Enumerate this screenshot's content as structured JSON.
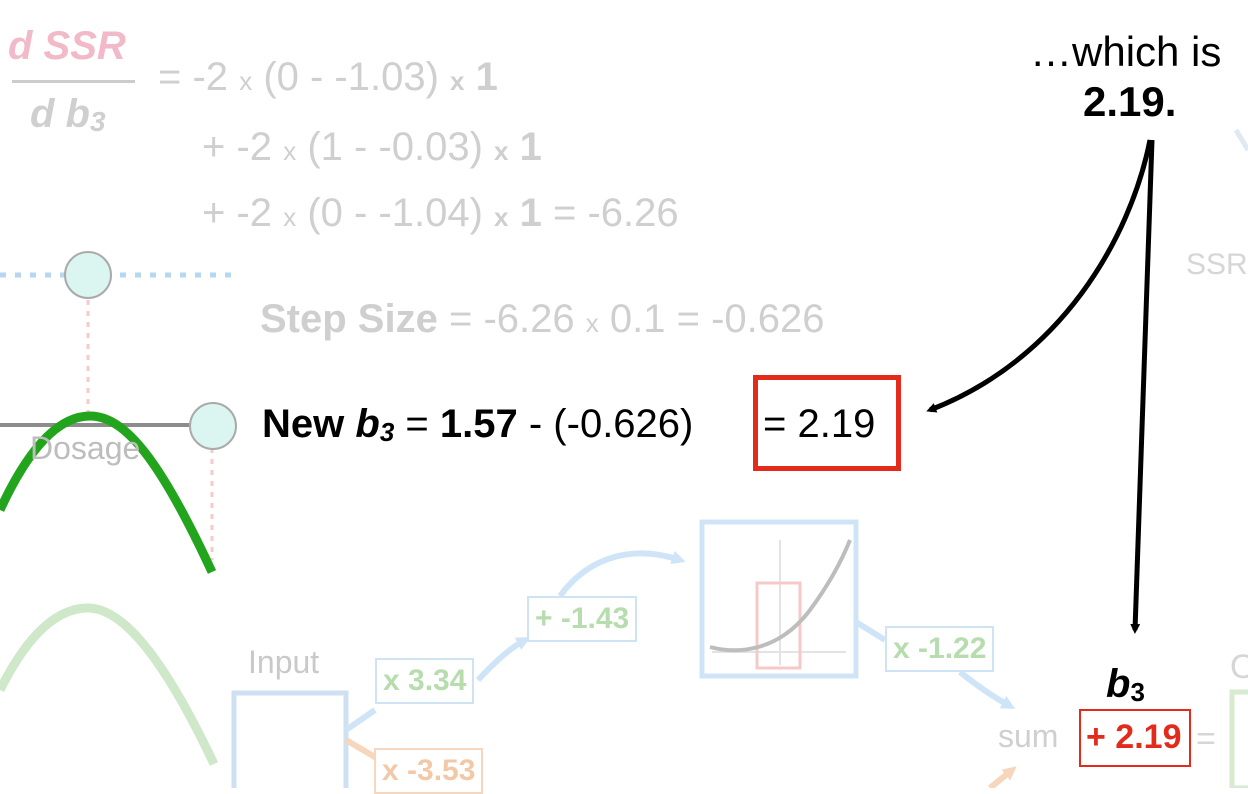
{
  "derivative": {
    "numerator": "d SSR",
    "denominator": "d b",
    "denominator_subscript": "3",
    "line1": {
      "eq": "=",
      "a": "-2",
      "x1": "x",
      "paren": "(0 - -1.03)",
      "x2": "x",
      "one": "1"
    },
    "line2": {
      "plus": "+",
      "a": "-2",
      "x1": "x",
      "paren": "(1 - -0.03)",
      "x2": "x",
      "one": "1"
    },
    "line3": {
      "plus": "+",
      "a": "-2",
      "x1": "x",
      "paren": "(0 - -1.04)",
      "x2": "x",
      "one": "1",
      "result": "= -6.26"
    }
  },
  "step_size": {
    "label": "Step Size",
    "eq1": "= -6.26",
    "x": "x",
    "lr": "0.1 = -0.626"
  },
  "new_b3": {
    "label": "New",
    "var": "b",
    "sub": "3",
    "eq": "=",
    "old": "1.57",
    "minus": "- (-0.626)",
    "result": "= 2.19"
  },
  "callout": {
    "line1": "…which is",
    "line2": "2.19."
  },
  "ssr_partial": "SSR",
  "network": {
    "input_label": "Input",
    "weight1": "x 3.34",
    "bias1": "+ -1.43",
    "weight2": "x -1.22",
    "weight3": "x -3.53",
    "sum_label": "sum",
    "b3_label": "b",
    "b3_sub": "3",
    "b3_value": "+ 2.19",
    "equals": "=",
    "output_partial": "O"
  },
  "plot": {
    "x_label": "Dosage"
  },
  "colors": {
    "highlight_red": "#e22b1b",
    "curve_green": "#1fa01a",
    "curve_green_faint": "#c8e6c2",
    "dot_fill": "#d9f4f0",
    "dashed_blue": "#a9cdea",
    "dashed_pink": "#f6c2c2",
    "faint_text": "#cfcfcf"
  }
}
